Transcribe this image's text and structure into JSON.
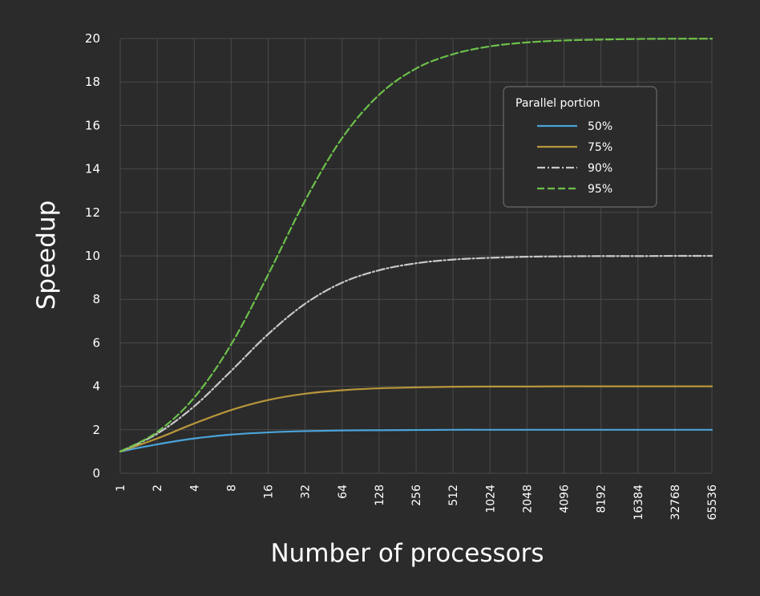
{
  "chart_data": {
    "type": "line",
    "x_tick_labels": [
      "1",
      "2",
      "4",
      "8",
      "16",
      "32",
      "64",
      "128",
      "256",
      "512",
      "1024",
      "2048",
      "4096",
      "8192",
      "16384",
      "32768",
      "65536"
    ],
    "x_scale": "log2",
    "xlabel": "Number of processors",
    "ylabel": "Speedup",
    "ylim": [
      0,
      20
    ],
    "y_ticks": [
      0,
      2,
      4,
      6,
      8,
      10,
      12,
      14,
      16,
      18,
      20
    ],
    "grid": true,
    "legend": {
      "title": "Parallel portion",
      "placement": "top-right"
    },
    "series": [
      {
        "name": "50%",
        "color": "#4aa3d9",
        "dash": "solid",
        "values": [
          1.0,
          1.33,
          1.6,
          1.78,
          1.88,
          1.94,
          1.97,
          1.98,
          1.99,
          2.0,
          2.0,
          2.0,
          2.0,
          2.0,
          2.0,
          2.0,
          2.0
        ]
      },
      {
        "name": "75%",
        "color": "#b8963a",
        "dash": "solid",
        "values": [
          1.0,
          1.6,
          2.29,
          2.91,
          3.37,
          3.66,
          3.82,
          3.91,
          3.95,
          3.98,
          3.99,
          3.99,
          4.0,
          4.0,
          4.0,
          4.0,
          4.0
        ]
      },
      {
        "name": "90%",
        "color": "#c8c8c8",
        "dash": "dashdot",
        "values": [
          1.0,
          1.82,
          3.08,
          4.71,
          6.4,
          7.8,
          8.77,
          9.34,
          9.66,
          9.83,
          9.91,
          9.96,
          9.98,
          9.99,
          9.99,
          10.0,
          10.0
        ]
      },
      {
        "name": "95%",
        "color": "#6cc04a",
        "dash": "dashed",
        "values": [
          1.0,
          1.9,
          3.48,
          5.93,
          9.14,
          12.55,
          15.42,
          17.41,
          18.62,
          19.28,
          19.64,
          19.82,
          19.91,
          19.95,
          19.98,
          19.99,
          19.99
        ]
      }
    ]
  }
}
